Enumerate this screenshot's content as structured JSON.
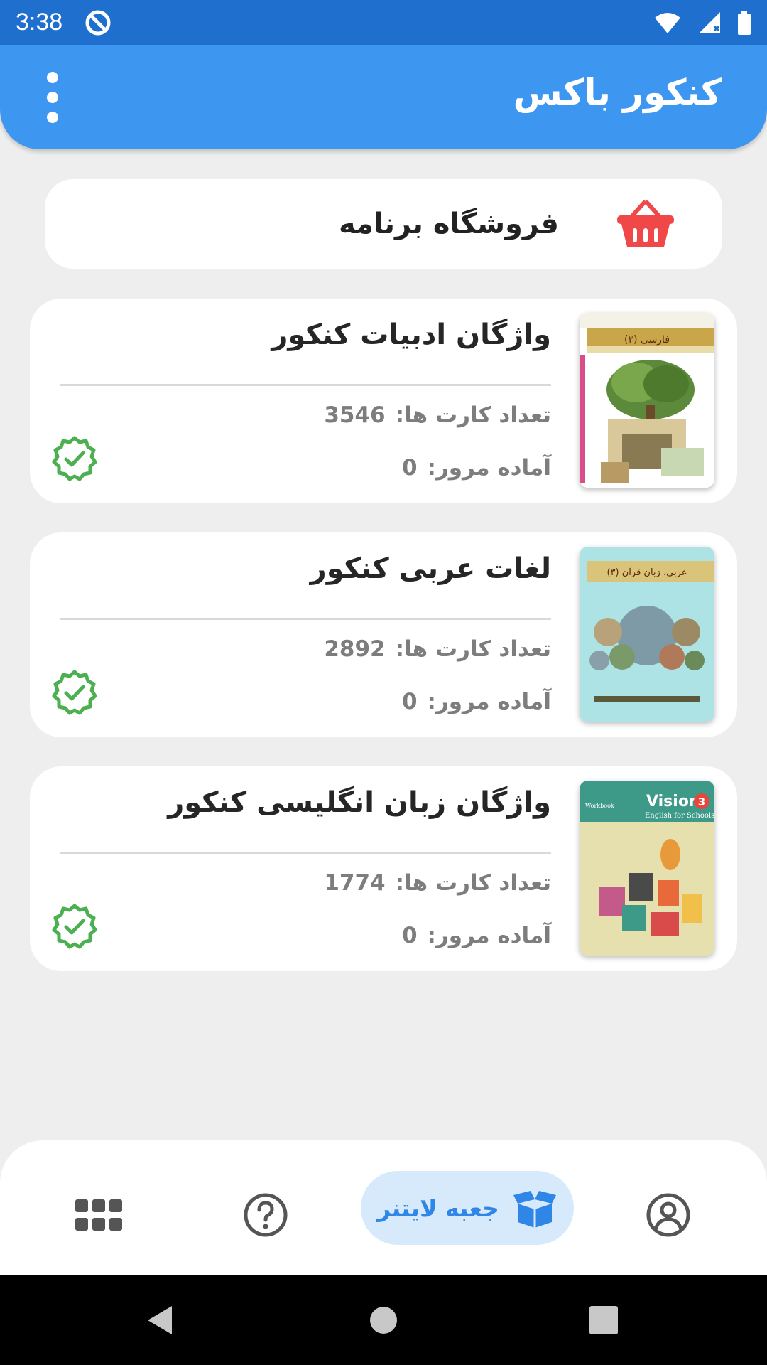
{
  "status": {
    "time": "3:38"
  },
  "appbar": {
    "title": "کنکور باکس"
  },
  "store": {
    "label": "فروشگاه برنامه"
  },
  "decks": [
    {
      "title": "واژگان ادبیات کنکور",
      "count_label": "تعداد کارت ها:",
      "count": "3546",
      "ready_label": "آماده مرور:",
      "ready": "0"
    },
    {
      "title": "لغات عربی کنکور",
      "count_label": "تعداد کارت ها:",
      "count": "2892",
      "ready_label": "آماده مرور:",
      "ready": "0"
    },
    {
      "title": "واژگان زبان انگلیسی کنکور",
      "count_label": "تعداد کارت ها:",
      "count": "1774",
      "ready_label": "آماده مرور:",
      "ready": "0"
    }
  ],
  "covers": {
    "persian": {
      "header": "فارسی (۳)"
    },
    "arabic": {
      "header": "عربی، زبان قرآن (۳)"
    },
    "english": {
      "title": "Vision",
      "num": "3",
      "subtitle": "English for Schools",
      "tag": "Workbook"
    }
  },
  "bottomnav": {
    "active_label": "جعبه لایتنر"
  },
  "colors": {
    "primary": "#3d96ef",
    "statusbar": "#1f6fcf",
    "check": "#4caf50",
    "basket": "#f04848"
  }
}
